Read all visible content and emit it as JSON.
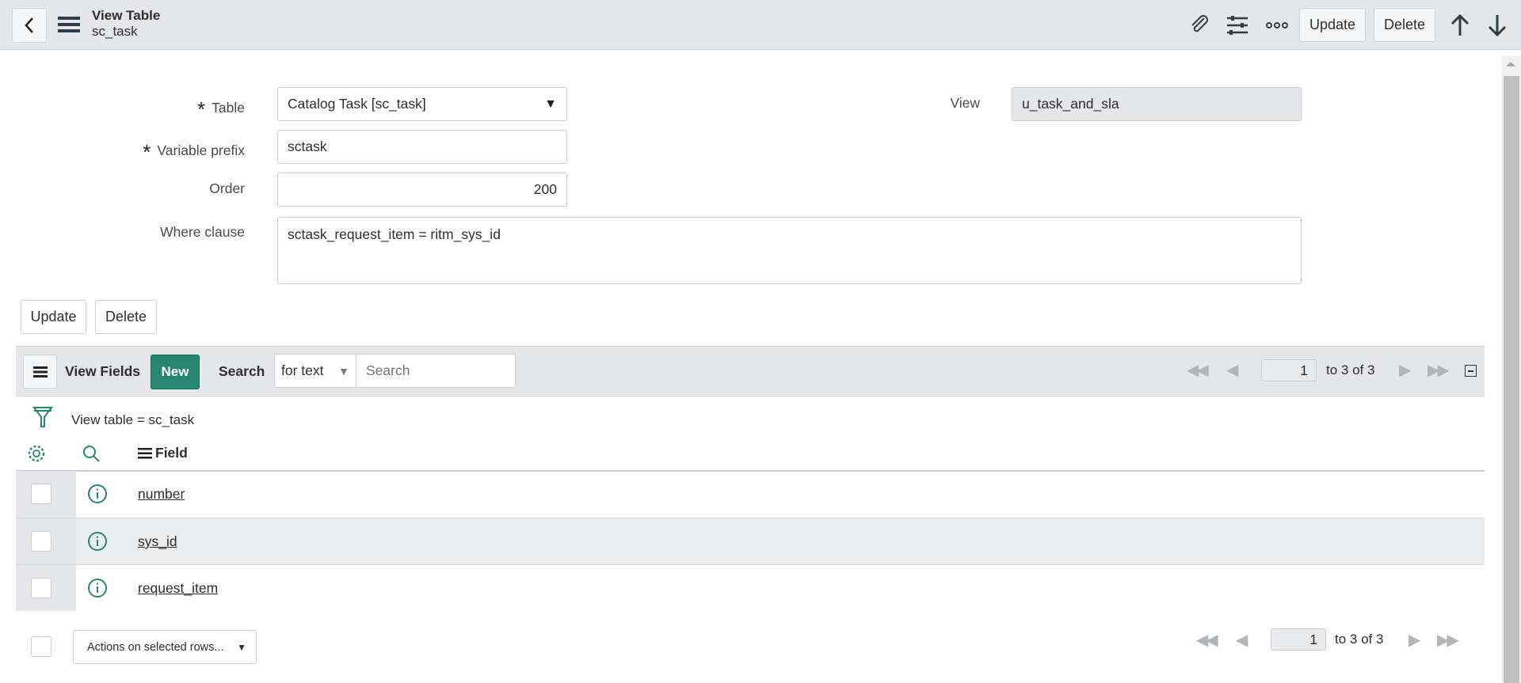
{
  "header": {
    "title": "View Table",
    "subtitle": "sc_task",
    "update": "Update",
    "delete": "Delete"
  },
  "form": {
    "table_label": "Table",
    "table_value": "Catalog Task [sc_task]",
    "prefix_label": "Variable prefix",
    "prefix_value": "sctask",
    "order_label": "Order",
    "order_value": "200",
    "where_label": "Where clause",
    "where_value": "sctask_request_item = ritm_sys_id",
    "view_label": "View",
    "view_value": "u_task_and_sla",
    "update": "Update",
    "delete": "Delete"
  },
  "list": {
    "title": "View Fields",
    "new": "New",
    "search_label": "Search",
    "search_mode": "for text",
    "search_placeholder": "Search",
    "page": "1",
    "range": "to 3 of 3",
    "filter": "View table = sc_task",
    "column": "Field",
    "rows": [
      {
        "field": "number"
      },
      {
        "field": "sys_id"
      },
      {
        "field": "request_item"
      }
    ],
    "actions": "Actions on selected rows...",
    "footer_page": "1",
    "footer_range": "to 3 of 3"
  },
  "colors": {
    "accent": "#278572",
    "header_bg": "#e4e6e9"
  }
}
